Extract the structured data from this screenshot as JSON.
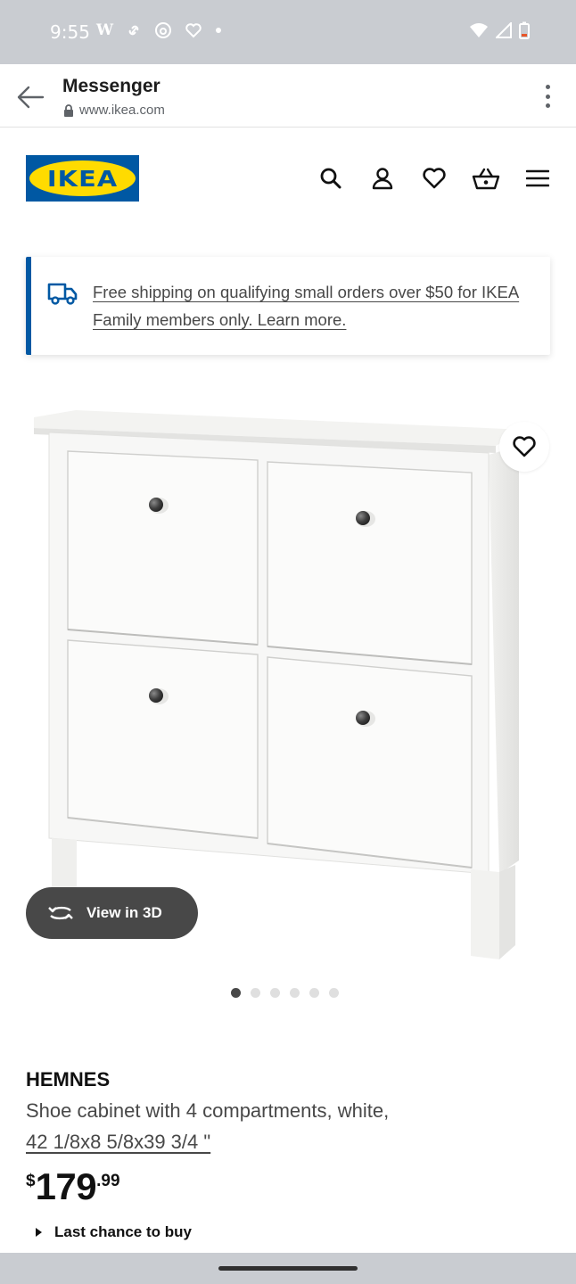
{
  "status_bar": {
    "time": "9:55",
    "left_icons": [
      "w-icon",
      "link-icon",
      "threads-icon",
      "heart-outline-icon",
      "dot-icon"
    ],
    "right_icons": [
      "wifi-icon",
      "signal-icon",
      "battery-low-icon"
    ]
  },
  "tab": {
    "title": "Messenger",
    "url": "www.ikea.com"
  },
  "header": {
    "logo_text": "IKEA",
    "icons": [
      "search-icon",
      "account-icon",
      "favourites-icon",
      "basket-icon",
      "menu-icon"
    ]
  },
  "banner": {
    "text": "Free shipping on qualifying small orders over $50 for IKEA Family members only. Learn more."
  },
  "product": {
    "view_3d_label": "View in 3D",
    "carousel_count": 6,
    "carousel_active": 1,
    "name": "HEMNES",
    "description": "Shoe cabinet with 4 compartments, white,",
    "dimensions": "42 1/8x8 5/8x39 3/4 \"",
    "price_currency": "$",
    "price_integer": "179",
    "price_decimal": ".99",
    "availability": "Last chance to buy"
  },
  "colors": {
    "ikea_blue": "#0058a3",
    "ikea_yellow": "#ffdb00",
    "dark_gray": "#484848"
  }
}
